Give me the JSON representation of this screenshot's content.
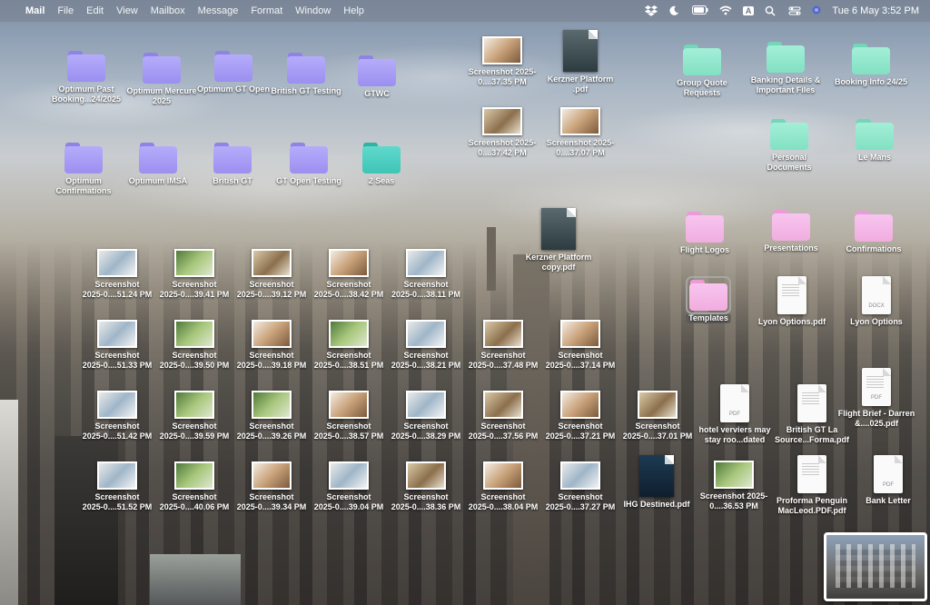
{
  "menubar": {
    "app": "Mail",
    "menus": [
      "File",
      "Edit",
      "View",
      "Mailbox",
      "Message",
      "Format",
      "Window",
      "Help"
    ],
    "datetime": "Tue 6 May  3:52 PM",
    "input_indicator": "A"
  },
  "desktop": {
    "folders_row1": [
      {
        "label": "Optimum Past Booking...24/2025",
        "color": "purple"
      },
      {
        "label": "Optimum Mercure 2025",
        "color": "purple"
      },
      {
        "label": "Optimum GT Open",
        "color": "purple"
      },
      {
        "label": "British GT Testing",
        "color": "purple"
      },
      {
        "label": "GTWC",
        "color": "purple"
      }
    ],
    "folders_row2": [
      {
        "label": "Optimum Confirmations",
        "color": "purple"
      },
      {
        "label": "Optimum IMSA",
        "color": "purple"
      },
      {
        "label": "British GT",
        "color": "purple"
      },
      {
        "label": "GT Open Testing",
        "color": "purple"
      },
      {
        "label": "2 Seas",
        "color": "teal"
      }
    ],
    "top_files": [
      {
        "label": "Screenshot 2025-0....37.35 PM",
        "kind": "thumb"
      },
      {
        "label": "Kerzner Platform .pdf",
        "kind": "pdfthumb"
      },
      {
        "label": "Screenshot 2025-0....37.42 PM",
        "kind": "thumb"
      },
      {
        "label": "Screenshot 2025-0....37.07 PM",
        "kind": "thumb"
      },
      {
        "label": "Kerzner Platform copy.pdf",
        "kind": "pdfthumb"
      }
    ],
    "right_folders": [
      {
        "label": "Group Quote Requests",
        "color": "mint"
      },
      {
        "label": "Banking Details & Important Files",
        "color": "mint"
      },
      {
        "label": "Booking Info 24/25",
        "color": "mint"
      },
      {
        "label": "Personal Documents",
        "color": "mint"
      },
      {
        "label": "Le Mans",
        "color": "mint"
      },
      {
        "label": "Flight Logos",
        "color": "pink"
      },
      {
        "label": "Presentations",
        "color": "pink"
      },
      {
        "label": "Confirmations",
        "color": "pink"
      },
      {
        "label": "Templates",
        "color": "pink"
      }
    ],
    "right_docs": [
      {
        "label": "Lyon Options.pdf",
        "tag": ""
      },
      {
        "label": "Lyon Options",
        "tag": "DOCX"
      },
      {
        "label": "Flight Brief - Darren &....025.pdf",
        "tag": "PDF"
      },
      {
        "label": "hotel verviers may stay roo...dated",
        "tag": "PDF"
      },
      {
        "label": "British GT La Source...Forma.pdf",
        "tag": ""
      },
      {
        "label": "Proforma Penguin MacLeod.PDF.pdf",
        "tag": ""
      },
      {
        "label": "Bank Letter",
        "tag": "PDF"
      },
      {
        "label": "IHG Destined.pdf",
        "tag": ""
      },
      {
        "label": "Screenshot 2025-0....36.53 PM",
        "tag": ""
      }
    ],
    "screenshot_rows": [
      [
        "2025-0....51.24 PM",
        "2025-0....39.41 PM",
        "2025-0....39.12 PM",
        "2025-0....38.42 PM",
        "2025-0....38.11 PM"
      ],
      [
        "2025-0....51.33 PM",
        "2025-0....39.50 PM",
        "2025-0....39.18 PM",
        "2025-0....38.51 PM",
        "2025-0....38.21 PM",
        "2025-0....37.48 PM",
        "2025-0....37.14 PM"
      ],
      [
        "2025-0....51.42 PM",
        "2025-0....39.59 PM",
        "2025-0....39.26 PM",
        "2025-0....38.57 PM",
        "2025-0....38.29 PM",
        "2025-0....37.56 PM",
        "2025-0....37.21 PM",
        "2025-0....37.01 PM"
      ],
      [
        "2025-0....51.52 PM",
        "2025-0....40.06 PM",
        "2025-0....39.34 PM",
        "2025-0....39.04 PM",
        "2025-0....38.36 PM",
        "2025-0....38.04 PM",
        "2025-0....37.27 PM"
      ]
    ],
    "screenshot_title": "Screenshot"
  }
}
